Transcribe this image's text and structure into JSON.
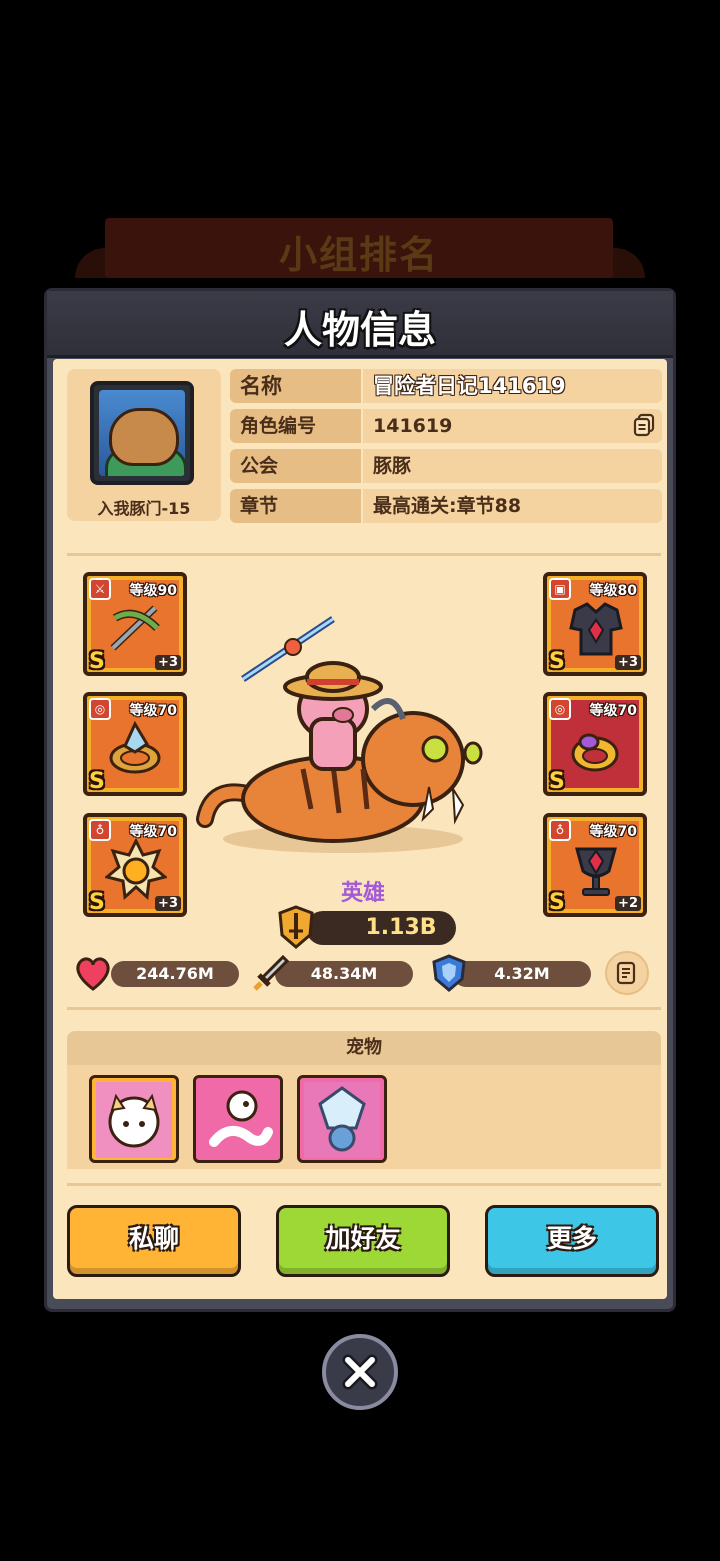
{
  "background": {
    "banner_text": "小组排名"
  },
  "modal": {
    "title": "人物信息"
  },
  "profile": {
    "avatar_caption": "入我豚门-15",
    "fields": [
      {
        "key": "名称",
        "value": "冒险者日记141619"
      },
      {
        "key": "角色编号",
        "value": "141619"
      },
      {
        "key": "公会",
        "value": "豚豚"
      },
      {
        "key": "章节",
        "value": "最高通关:章节88"
      }
    ]
  },
  "equipment": {
    "left": [
      {
        "level": "等级90",
        "rank": "S",
        "plus": "+3",
        "icon": "crossbow-icon",
        "frame": "orange"
      },
      {
        "level": "等级70",
        "rank": "S",
        "plus": "",
        "icon": "crystal-ring-icon",
        "frame": "orange"
      },
      {
        "level": "等级70",
        "rank": "S",
        "plus": "+3",
        "icon": "sun-medal-icon",
        "frame": "orange"
      }
    ],
    "right": [
      {
        "level": "等级80",
        "rank": "S",
        "plus": "+3",
        "icon": "dark-armor-icon",
        "frame": "orange"
      },
      {
        "level": "等级70",
        "rank": "S",
        "plus": "",
        "icon": "gold-ring-icon",
        "frame": "red"
      },
      {
        "level": "等级70",
        "rank": "S",
        "plus": "+2",
        "icon": "dark-chalice-icon",
        "frame": "orange"
      }
    ]
  },
  "hero": {
    "label": "英雄",
    "power": "1.13B"
  },
  "stats": {
    "hp": "244.76M",
    "attack": "48.34M",
    "defense": "4.32M"
  },
  "pets": {
    "header": "宠物",
    "items": [
      "cat-girl-pet-icon",
      "pink-dragon-pet-icon",
      "ice-crystal-pet-icon"
    ]
  },
  "buttons": {
    "chat": "私聊",
    "add_friend": "加好友",
    "more": "更多"
  },
  "colors": {
    "panel": "#fbe5bd",
    "chat_button": "#ffb436",
    "friend_button": "#9ed836",
    "more_button": "#3ec6e6",
    "hero_label": "#a35ad8"
  }
}
